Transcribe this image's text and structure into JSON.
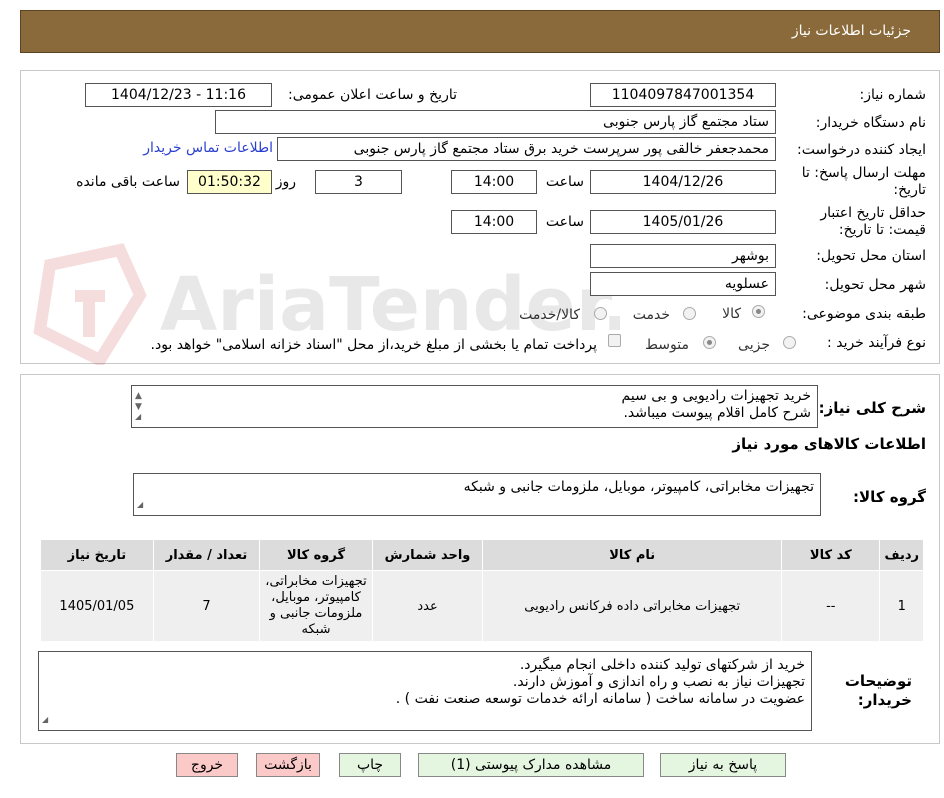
{
  "header": {
    "title": "جزئیات اطلاعات نیاز"
  },
  "form": {
    "need_number_label": "شماره نیاز:",
    "need_number": "1104097847001354",
    "announce_label": "تاریخ و ساعت اعلان عمومی:",
    "announce_value": "1404/12/23 - 11:16",
    "buyer_org_label": "نام دستگاه خریدار:",
    "buyer_org": "ستاد مجتمع گاز پارس جنوبی",
    "requester_label": "ایجاد کننده درخواست:",
    "requester": "محمدجعفر خالقی پور سرپرست خرید برق ستاد مجتمع گاز پارس جنوبی",
    "contact_link": "اطلاعات تماس خریدار",
    "deadline_label": "مهلت ارسال پاسخ: تا تاریخ:",
    "deadline_date": "1404/12/26",
    "time_label": "ساعت",
    "deadline_time": "14:00",
    "days_value": "3",
    "days_label": "روز و",
    "remaining_time": "01:50:32",
    "remaining_label": "ساعت باقی مانده",
    "validity_label": "حداقل تاریخ اعتبار قیمت: تا تاریخ:",
    "validity_date": "1405/01/26",
    "validity_time_label": "ساعت",
    "validity_time": "14:00",
    "province_label": "استان محل تحویل:",
    "province": "بوشهر",
    "city_label": "شهر محل تحویل:",
    "city": "عسلویه",
    "category_label": "طبقه بندی موضوعی:",
    "category_options": [
      "کالا",
      "خدمت",
      "کالا/خدمت"
    ],
    "process_label": "نوع فرآیند خرید :",
    "process_options": [
      "جزیی",
      "متوسط"
    ],
    "payment_note": "پرداخت تمام یا بخشی از مبلغ خرید،از محل \"اسناد خزانه اسلامی\" خواهد بود."
  },
  "summary": {
    "label": "شرح کلی نیاز:",
    "line1": "خرید تجهیزات رادیویی و بی سیم",
    "line2": "شرح کامل اقلام پیوست میباشد."
  },
  "goods_section": {
    "title": "اطلاعات کالاهای مورد نیاز",
    "group_label": "گروه کالا:",
    "group_value": "تجهیزات مخابراتی، کامپیوتر، موبایل، ملزومات جانبی و شبکه"
  },
  "table": {
    "headers": [
      "ردیف",
      "کد کالا",
      "نام کالا",
      "واحد شمارش",
      "گروه کالا",
      "تعداد / مقدار",
      "تاریخ نیاز"
    ],
    "rows": [
      {
        "row": "1",
        "code": "--",
        "name": "تجهیزات مخابراتی داده فرکانس رادیویی",
        "unit": "عدد",
        "group": "تجهیزات مخابراتی، کامپیوتر، موبایل، ملزومات جانبی و شبکه",
        "qty": "7",
        "date": "1405/01/05"
      }
    ]
  },
  "notes": {
    "label": "توضیحات خریدار:",
    "line1": "خرید از شرکتهای تولید کننده داخلی انجام میگیرد.",
    "line2": "تجهیزات نیاز به نصب و راه اندازی و آموزش دارند.",
    "line3": "عضویت در سامانه ساخت ( سامانه ارائه خدمات توسعه صنعت نفت ) ."
  },
  "buttons": {
    "reply": "پاسخ به نیاز",
    "attachments": "مشاهده مدارک پیوستی (1)",
    "print": "چاپ",
    "back": "بازگشت",
    "exit": "خروج"
  },
  "watermark_text": "AriaTender.neT"
}
